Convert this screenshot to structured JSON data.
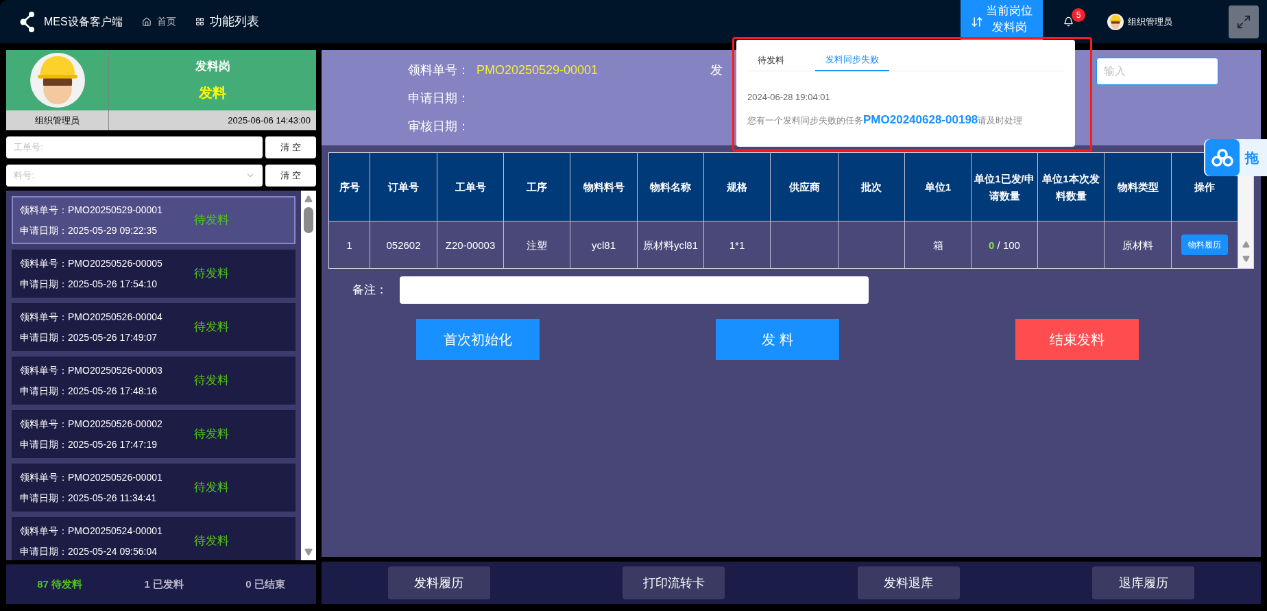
{
  "topbar": {
    "app_name": "MES设备客户端",
    "nav": [
      {
        "label": "首页",
        "kind": "home",
        "selected": false
      },
      {
        "label": "功能列表",
        "kind": "grid",
        "selected": true
      }
    ],
    "station_switch": {
      "line1": "当前岗位",
      "line2": "发料岗",
      "selected": true
    },
    "notifications": {
      "count": "5"
    },
    "user": {
      "name": "组织管理员"
    }
  },
  "popup": {
    "tabs": [
      {
        "label": "待发料",
        "selected": false
      },
      {
        "label": "发料同步失败",
        "selected": true
      }
    ],
    "messages": [
      {
        "time": "2024-06-28 19:04:01",
        "text": "您有一个发料同步失败的任务**PMO20240628-00198**请及时处理"
      }
    ]
  },
  "float_button": {
    "label": "拖"
  },
  "sidebar": {
    "profile": {
      "station": "发料岗",
      "action": "发料",
      "user": "组织管理员",
      "datetime": "2025-06-06 14:43:00"
    },
    "filters": [
      {
        "placeholder": "工单号:",
        "kind": "text",
        "button": "清 空"
      },
      {
        "placeholder": "料号:",
        "kind": "select",
        "button": "清 空"
      }
    ],
    "orders": [
      {
        "number_label": "领料单号：",
        "number": "PMO20250529-00001",
        "date_label": "申请日期：",
        "date": "2025-05-29 09:22:35",
        "status": "待发料",
        "selected": true
      },
      {
        "number_label": "领料单号：",
        "number": "PMO20250526-00005",
        "date_label": "申请日期：",
        "date": "2025-05-26 17:54:10",
        "status": "待发料",
        "selected": false
      },
      {
        "number_label": "领料单号：",
        "number": "PMO20250526-00004",
        "date_label": "申请日期：",
        "date": "2025-05-26 17:49:07",
        "status": "待发料",
        "selected": false
      },
      {
        "number_label": "领料单号：",
        "number": "PMO20250526-00003",
        "date_label": "申请日期：",
        "date": "2025-05-26 17:48:16",
        "status": "待发料",
        "selected": false
      },
      {
        "number_label": "领料单号：",
        "number": "PMO20250526-00002",
        "date_label": "申请日期：",
        "date": "2025-05-26 17:47:19",
        "status": "待发料",
        "selected": false
      },
      {
        "number_label": "领料单号：",
        "number": "PMO20250526-00001",
        "date_label": "申请日期：",
        "date": "2025-05-26 11:34:41",
        "status": "待发料",
        "selected": false
      },
      {
        "number_label": "领料单号：",
        "number": "PMO20250524-00001",
        "date_label": "申请日期：",
        "date": "2025-05-24 09:56:04",
        "status": "待发料",
        "selected": false
      }
    ],
    "counts": [
      {
        "label": "87 待发料",
        "color": "#52c41a"
      },
      {
        "label": "1 已发料",
        "color": "#b8b8c8"
      },
      {
        "label": "0 已结束",
        "color": "#b8b8c8"
      }
    ]
  },
  "header": {
    "order_label": "领料单号：",
    "order_value": "PMO20250529-00001",
    "apply_label": "申请日期：",
    "review_label": "审核日期：",
    "cut_label": "发",
    "input_placeholder": "输入"
  },
  "table": {
    "columns": [
      "序号",
      "订单号",
      "工单号",
      "工序",
      "物料料号",
      "物料名称",
      "规格",
      "供应商",
      "批次",
      "单位1",
      "单位1已发/申请数量",
      "单位1本次发料数量",
      "物料类型",
      "操作"
    ],
    "rows": [
      {
        "cells": [
          "1",
          "052602",
          "Z20-00003",
          "注塑",
          "ycl81",
          "原材料ycl81",
          "1*1",
          "",
          "",
          "箱",
          null,
          "",
          "原材料"
        ],
        "issued": "0",
        "requested": "/ 100",
        "action": "物料履历"
      }
    ]
  },
  "remark": {
    "label": "备注："
  },
  "actions": [
    {
      "label": "首次初始化",
      "kind": "primary"
    },
    {
      "label": "发 料",
      "kind": "primary"
    },
    {
      "label": "结束发料",
      "kind": "danger"
    }
  ],
  "bottom_buttons": [
    "发料履历",
    "打印流转卡",
    "发料退库",
    "退库履历"
  ]
}
